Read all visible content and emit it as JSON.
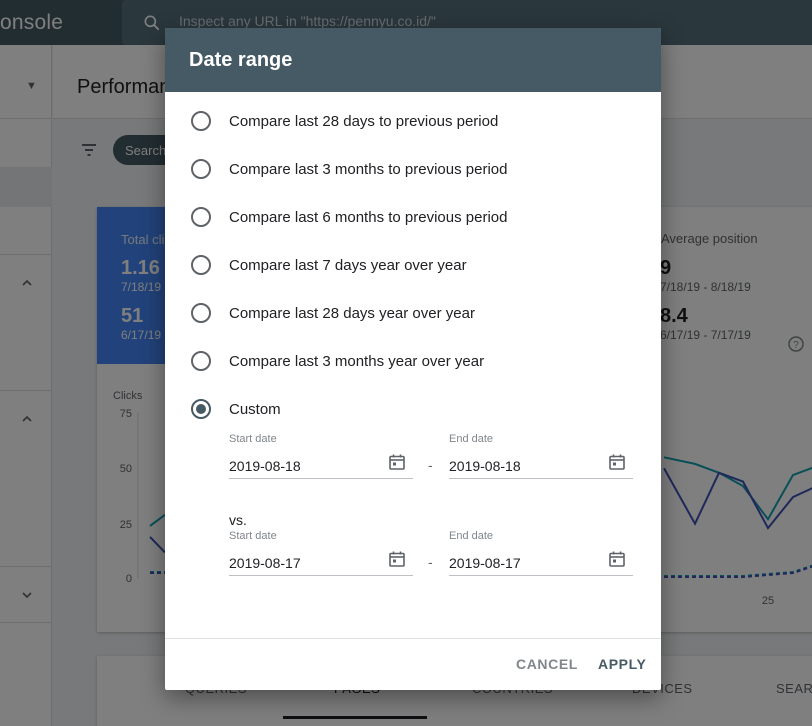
{
  "app": {
    "title": "onsole",
    "search_placeholder": "Inspect any URL in \"https://pennyu.co.id/\""
  },
  "page": {
    "title": "Performan",
    "filter_chip": "Search"
  },
  "metrics": {
    "clicks_label": "Total cli",
    "clicks_value": "1.16",
    "clicks_date": "7/18/19",
    "clicks_prev_value": "51",
    "clicks_prev_date": "6/17/19",
    "avg_position_label": "Average position",
    "avg_position_value": "9",
    "avg_position_date": "7/18/19 - 8/18/19",
    "avg_position_prev_value": "8.4",
    "avg_position_prev_date": "6/17/19 - 7/17/19"
  },
  "chart": {
    "ylabel": "Clicks",
    "yticks": [
      "75",
      "50",
      "25",
      "0"
    ],
    "xtick": "25"
  },
  "chart_data": {
    "type": "line",
    "ylabel": "Clicks",
    "ylim": [
      0,
      75
    ],
    "xticks_visible": [
      "25"
    ],
    "series": [
      {
        "values": [
          24,
          29
        ]
      },
      {
        "values": [
          19,
          12
        ]
      },
      {
        "values": [
          55,
          52,
          48,
          42,
          27,
          47,
          51
        ]
      },
      {
        "values": [
          50,
          25,
          48,
          44,
          23,
          37,
          42
        ]
      }
    ]
  },
  "tabs": [
    "QUERIES",
    "PAGES",
    "COUNTRIES",
    "DEVICES",
    "SEARC"
  ],
  "dialog": {
    "title": "Date range",
    "options": [
      {
        "label": "Compare last 28 days to previous period",
        "selected": false
      },
      {
        "label": "Compare last 3 months to previous period",
        "selected": false
      },
      {
        "label": "Compare last 6 months to previous period",
        "selected": false
      },
      {
        "label": "Compare last 7 days year over year",
        "selected": false
      },
      {
        "label": "Compare last 28 days year over year",
        "selected": false
      },
      {
        "label": "Compare last 3 months year over year",
        "selected": false
      },
      {
        "label": "Custom",
        "selected": true
      }
    ],
    "range1": {
      "start_label": "Start date",
      "start_value": "2019-08-18",
      "end_label": "End date",
      "end_value": "2019-08-18"
    },
    "vs_label": "vs.",
    "range2": {
      "start_label": "Start date",
      "start_value": "2019-08-17",
      "end_label": "End date",
      "end_value": "2019-08-17"
    },
    "separator": "-",
    "cancel_label": "CANCEL",
    "apply_label": "APPLY"
  }
}
